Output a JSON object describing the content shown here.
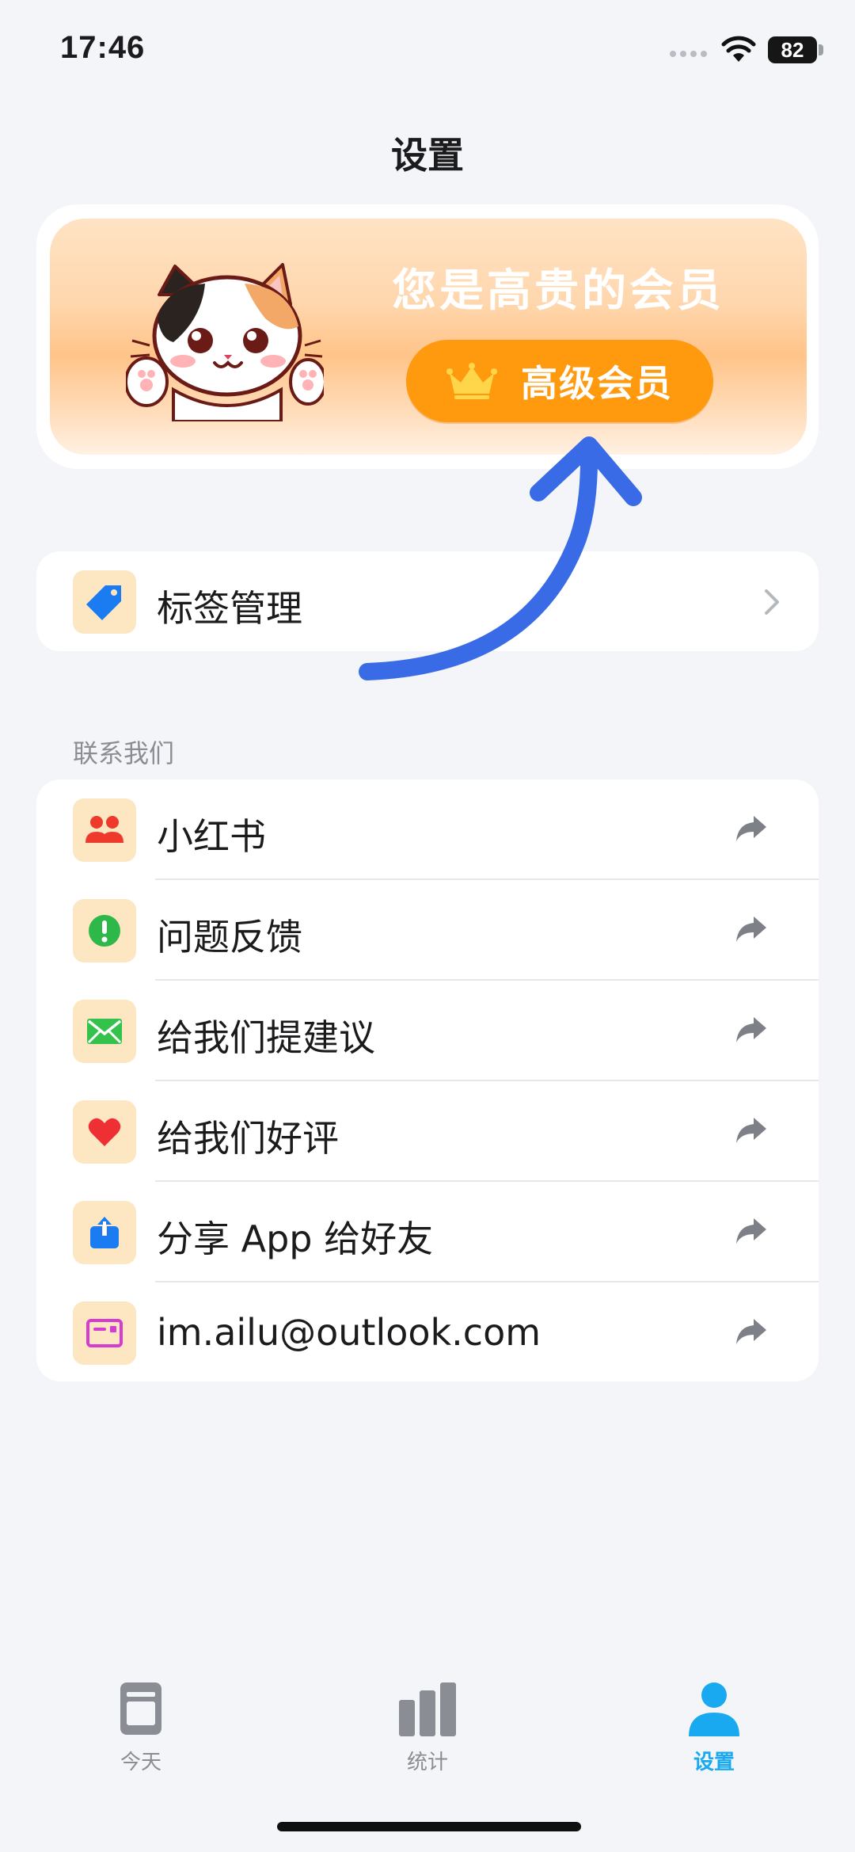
{
  "status_bar": {
    "time": "17:46",
    "battery": "82"
  },
  "page": {
    "title": "设置"
  },
  "member_card": {
    "title": "您是高贵的会员",
    "button_label": "高级会员",
    "button_color": "#ff9a0f"
  },
  "tag_management": {
    "label": "标签管理",
    "icon": "tag-icon"
  },
  "contact": {
    "header": "联系我们",
    "items": [
      {
        "label": "小红书",
        "icon": "people-icon",
        "icon_color": "#ee3a2c"
      },
      {
        "label": "问题反馈",
        "icon": "exclamation-circle-icon",
        "icon_color": "#2fb84a"
      },
      {
        "label": "给我们提建议",
        "icon": "envelope-icon",
        "icon_color": "#35c24c"
      },
      {
        "label": "给我们好评",
        "icon": "heart-icon",
        "icon_color": "#ee3035"
      },
      {
        "label": "分享 App 给好友",
        "icon": "share-icon",
        "icon_color": "#1a7cf0"
      },
      {
        "label": "im.ailu@outlook.com",
        "icon": "mail-card-icon",
        "icon_color": "#d63cd0"
      }
    ]
  },
  "tab_bar": {
    "tabs": [
      {
        "label": "今天",
        "icon": "calendar-icon",
        "active": false
      },
      {
        "label": "统计",
        "icon": "bar-chart-icon",
        "active": false
      },
      {
        "label": "设置",
        "icon": "person-icon",
        "active": true
      }
    ],
    "active_color": "#19a9f0",
    "inactive_color": "#8a8d93"
  }
}
